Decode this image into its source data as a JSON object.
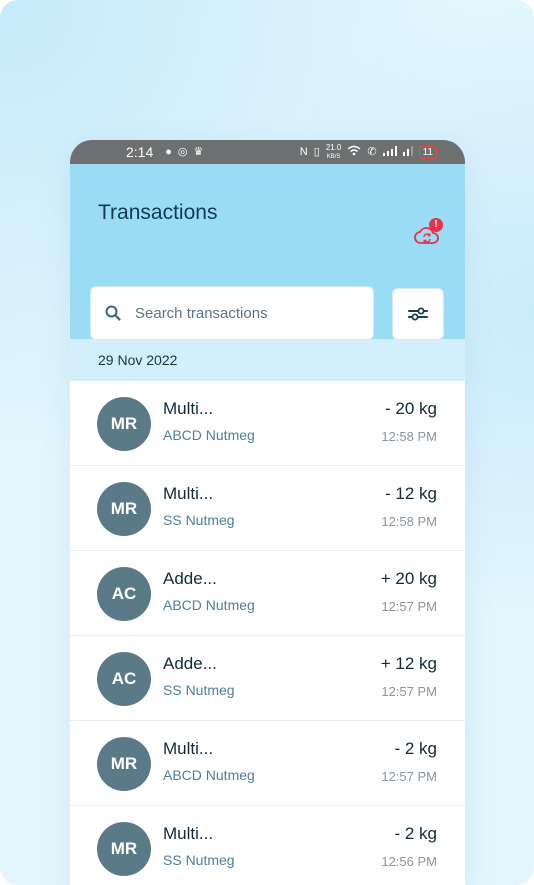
{
  "status_bar": {
    "time": "2:14",
    "speed": "21.0",
    "speed_unit": "KB/S",
    "battery": "11"
  },
  "header": {
    "title": "Transactions",
    "sync_badge": "!"
  },
  "search": {
    "placeholder": "Search transactions"
  },
  "colors": {
    "header_bg": "#9bdcf5",
    "date_band_bg": "#d2effb",
    "avatar_bg": "#5a7a88",
    "badge": "#e8324b",
    "sync_icon": "#e8324b"
  },
  "date_group": "29 Nov 2022",
  "transactions": [
    {
      "initials": "MR",
      "name": "Multi...",
      "account": "ABCD Nutmeg",
      "amount": "- 20 kg",
      "time": "12:58 PM"
    },
    {
      "initials": "MR",
      "name": "Multi...",
      "account": "SS Nutmeg",
      "amount": "- 12 kg",
      "time": "12:58 PM"
    },
    {
      "initials": "AC",
      "name": "Adde...",
      "account": "ABCD Nutmeg",
      "amount": "+ 20 kg",
      "time": "12:57 PM"
    },
    {
      "initials": "AC",
      "name": "Adde...",
      "account": "SS Nutmeg",
      "amount": "+ 12 kg",
      "time": "12:57 PM"
    },
    {
      "initials": "MR",
      "name": "Multi...",
      "account": "ABCD Nutmeg",
      "amount": "- 2 kg",
      "time": "12:57 PM"
    },
    {
      "initials": "MR",
      "name": "Multi...",
      "account": "SS Nutmeg",
      "amount": "- 2 kg",
      "time": "12:56 PM"
    }
  ]
}
